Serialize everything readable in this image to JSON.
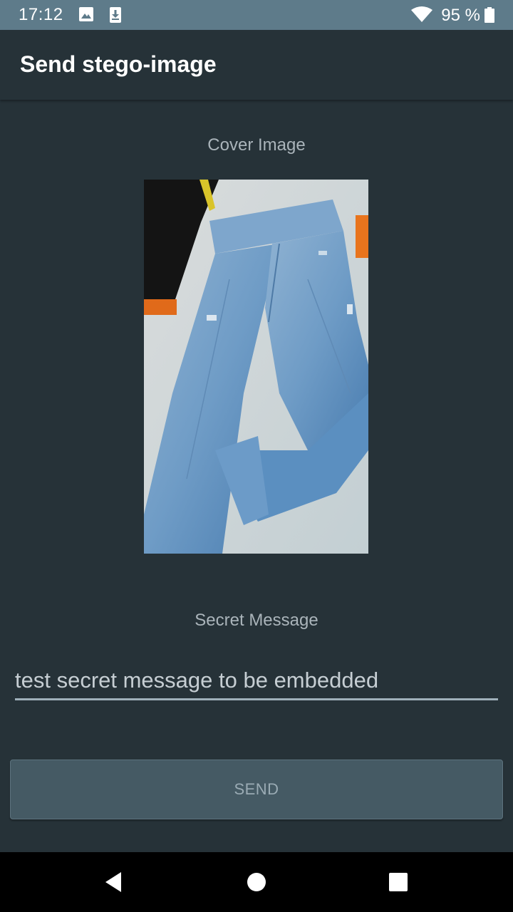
{
  "status_bar": {
    "time": "17:12",
    "battery": "95 %",
    "icons": [
      "image-icon",
      "download-icon",
      "wifi-icon",
      "battery-icon"
    ]
  },
  "app_bar": {
    "title": "Send stego-image"
  },
  "cover": {
    "label": "Cover Image"
  },
  "secret": {
    "label": "Secret Message",
    "value": "test secret message to be embedded"
  },
  "actions": {
    "send_label": "SEND"
  },
  "nav": {
    "icons": [
      "back-icon",
      "home-icon",
      "recents-icon"
    ]
  },
  "colors": {
    "background": "#263238",
    "status_bar": "#5e7b8a",
    "button": "#455a64",
    "label": "#aab4ba"
  }
}
